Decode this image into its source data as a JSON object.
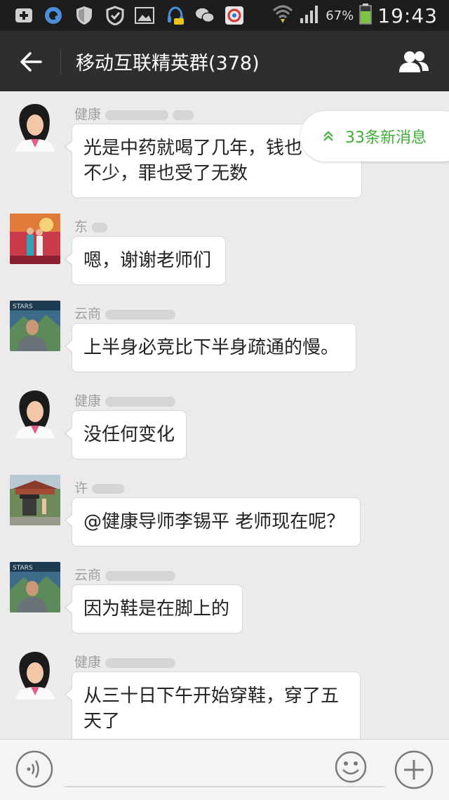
{
  "status_bar": {
    "battery_percent": "67%",
    "time": "19:43",
    "icons": [
      "add-notification-icon",
      "browser-icon",
      "shield-icon",
      "security-icon",
      "gallery-icon",
      "headset-icon",
      "wechat-icon",
      "app-icon",
      "wifi-icon",
      "signal-icon",
      "battery-icon"
    ]
  },
  "header": {
    "back_icon": "arrow-left-icon",
    "title": "移动互联精英群(378)",
    "members_icon": "group-members-icon"
  },
  "new_messages_badge": "33条新消息",
  "messages": [
    {
      "name": "健康",
      "text_lines": [
        "光是中药就喝了几年，钱也",
        "不少，罪也受了无数"
      ],
      "avatar": "woman"
    },
    {
      "name": "东",
      "text_lines": [
        "嗯，谢谢老师们"
      ],
      "avatar": "stage"
    },
    {
      "name": "云商",
      "text_lines": [
        "上半身必竞比下半身疏通的慢。"
      ],
      "avatar": "man"
    },
    {
      "name": "健康",
      "text_lines": [
        "没任何变化"
      ],
      "avatar": "woman"
    },
    {
      "name": "许",
      "text_lines": [
        "@健康导师李锡平 老师现在呢？"
      ],
      "avatar": "temple"
    },
    {
      "name": "云商",
      "text_lines": [
        "因为鞋是在脚上的"
      ],
      "avatar": "man"
    },
    {
      "name": "健康",
      "text_lines": [
        "从三十日下午开始穿鞋，穿了五",
        "天了"
      ],
      "avatar": "woman"
    }
  ],
  "input_bar": {
    "voice_icon": "voice-icon",
    "emoji_icon": "emoji-icon",
    "plus_icon": "plus-icon"
  }
}
